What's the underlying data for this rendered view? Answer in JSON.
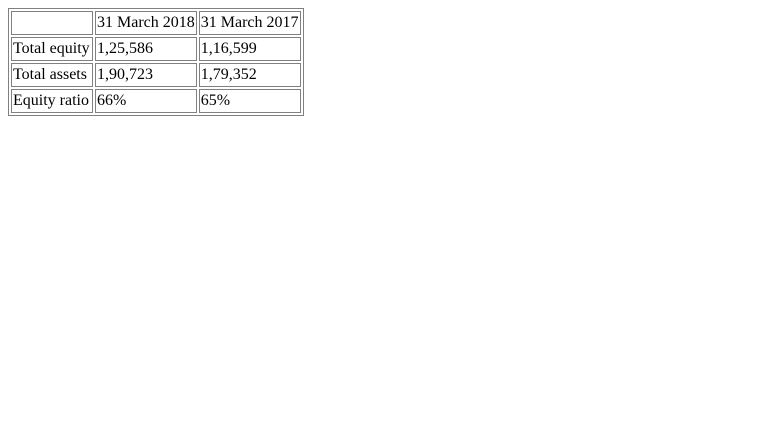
{
  "table": {
    "headers": [
      "",
      "31 March 2018",
      "31 March 2017"
    ],
    "rows": [
      [
        "Total equity",
        "1,25,586",
        "1,16,599"
      ],
      [
        "Total assets",
        "1,90,723",
        "1,79,352"
      ],
      [
        "Equity ratio",
        "66%",
        "65%"
      ]
    ]
  }
}
